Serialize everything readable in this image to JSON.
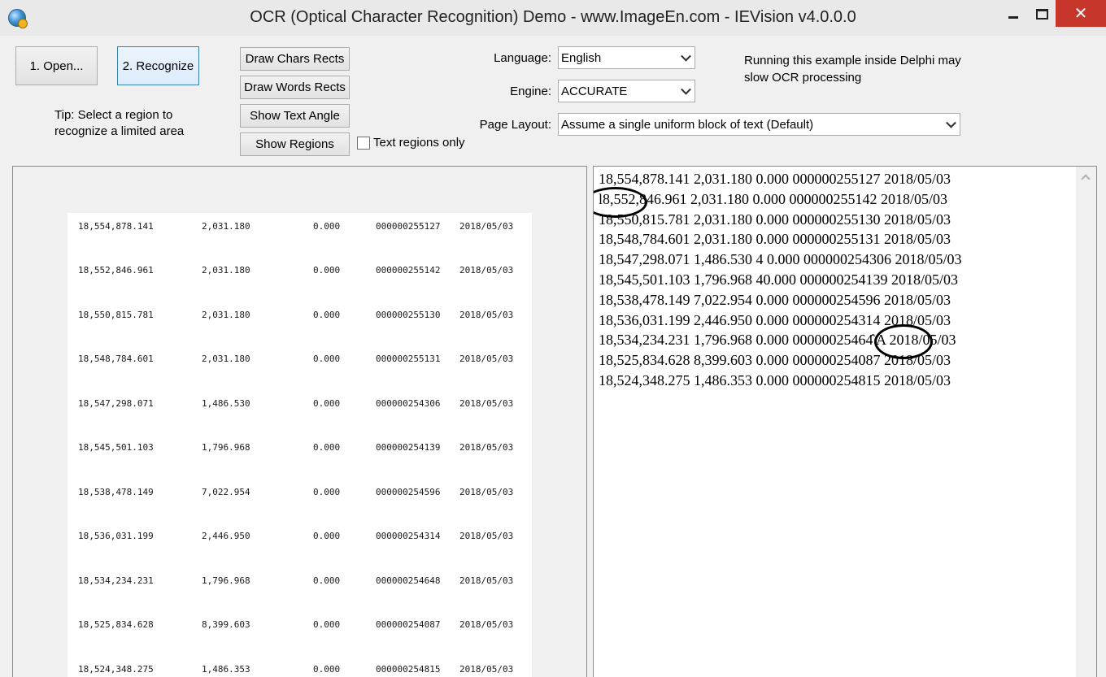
{
  "window": {
    "title": "OCR (Optical Character Recognition) Demo - www.ImageEn.com - IEVision v4.0.0.0",
    "close_glyph": "✕"
  },
  "toolbar": {
    "open_label": "1. Open...",
    "recognize_label": "2. Recognize",
    "tip": "Tip: Select a region to recognize a limited area",
    "draw_chars_label": "Draw Chars Rects",
    "draw_words_label": "Draw Words Rects",
    "show_angle_label": "Show Text Angle",
    "show_regions_label": "Show Regions",
    "text_regions_only_label": "Text regions only",
    "text_regions_only_checked": false
  },
  "settings": {
    "language_label": "Language:",
    "language_value": "English",
    "engine_label": "Engine:",
    "engine_value": "ACCURATE",
    "layout_label": "Page Layout:",
    "layout_value": "Assume a single uniform block of text (Default)"
  },
  "note": "Running this example inside Delphi may slow OCR processing",
  "scan_rows": [
    [
      "18,554,878.141",
      "2,031.180",
      "0.000",
      "000000255127",
      "2018/05/03"
    ],
    [
      "18,552,846.961",
      "2,031.180",
      "0.000",
      "000000255142",
      "2018/05/03"
    ],
    [
      "18,550,815.781",
      "2,031.180",
      "0.000",
      "000000255130",
      "2018/05/03"
    ],
    [
      "18,548,784.601",
      "2,031.180",
      "0.000",
      "000000255131",
      "2018/05/03"
    ],
    [
      "18,547,298.071",
      "1,486.530",
      "0.000",
      "000000254306",
      "2018/05/03"
    ],
    [
      "18,545,501.103",
      "1,796.968",
      "0.000",
      "000000254139",
      "2018/05/03"
    ],
    [
      "18,538,478.149",
      "7,022.954",
      "0.000",
      "000000254596",
      "2018/05/03"
    ],
    [
      "18,536,031.199",
      "2,446.950",
      "0.000",
      "000000254314",
      "2018/05/03"
    ],
    [
      "18,534,234.231",
      "1,796.968",
      "0.000",
      "000000254648",
      "2018/05/03"
    ],
    [
      "18,525,834.628",
      "8,399.603",
      "0.000",
      "000000254087",
      "2018/05/03"
    ],
    [
      "18,524,348.275",
      "1,486.353",
      "0.000",
      "000000254815",
      "2018/05/03"
    ]
  ],
  "ocr_result_lines": [
    "18,554,878.141 2,031.180 0.000 000000255127 2018/05/03",
    "l8,552,846.961 2,031.180 0.000 000000255142 2018/05/03",
    "18,550,815.781 2,031.180 0.000 000000255130 2018/05/03",
    "18,548,784.601 2,031.180 0.000 000000255131 2018/05/03",
    "18,547,298.071 1,486.530 4 0.000 000000254306 2018/05/03",
    "18,545,501.103 1,796.968 40.000 000000254139 2018/05/03",
    "18,538,478.149 7,022.954 0.000 000000254596 2018/05/03",
    "18,536,031.199 2,446.950 0.000 000000254314 2018/05/03",
    "18,534,234.231 1,796.968 0.000 00000025464̂ A 2018/05/03",
    "18,525,834.628 8,399.603 0.000 000000254087 2018/05/03",
    "18,524,348.275 1,486.353 0.000 000000254815 2018/05/03"
  ],
  "colors": {
    "close_button": "#c7362a",
    "focus_border": "#3c7fb1"
  },
  "icons": [
    "app-icon",
    "minimize-icon",
    "maximize-icon",
    "close-icon",
    "dropdown-arrow-icon",
    "scroll-up-arrow-icon"
  ]
}
